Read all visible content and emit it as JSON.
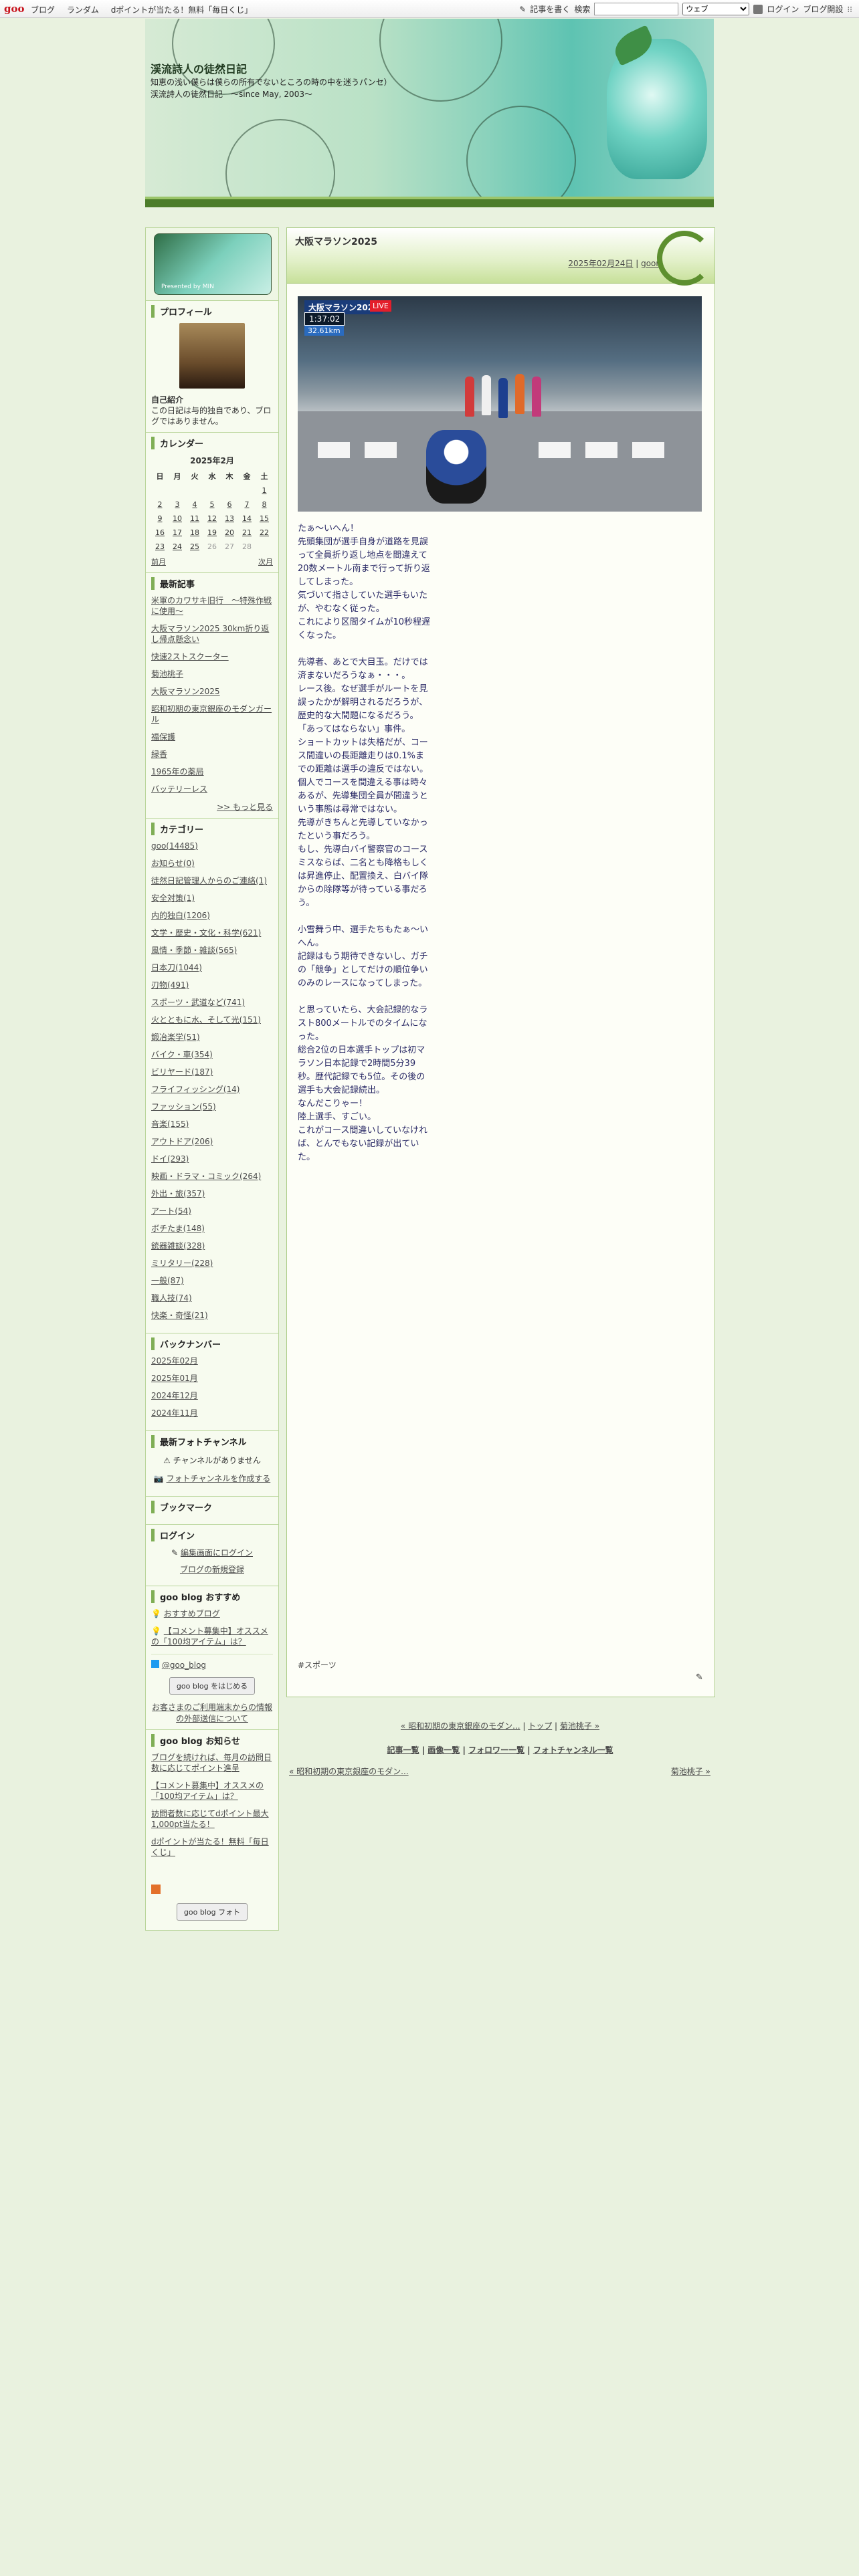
{
  "topbar": {
    "logo": "goo",
    "links": [
      "ブログ",
      "ランダム",
      "dポイントが当たる！無料「毎日くじ」"
    ],
    "write": "記事を書く",
    "search_label": "検索",
    "search_placeholder": "",
    "search_scope": "ウェブ",
    "login": "ログイン",
    "open_blog": "ブログ開設"
  },
  "header": {
    "title": "渓流詩人の徒然日記",
    "description": "知恵の浅い僕らは僕らの所有でないところの時の中を迷うパンセ）渓流詩人の徒然日記　〜since May, 2003〜"
  },
  "sidebar": {
    "badge_text": "Presented by MIN",
    "profile": {
      "heading": "プロフィール",
      "intro_label": "自己紹介",
      "intro_text": "この日記は与的独自であり、ブログではありません。"
    },
    "calendar": {
      "heading": "カレンダー",
      "month": "2025年2月",
      "weekdays": [
        "日",
        "月",
        "火",
        "水",
        "木",
        "金",
        "土"
      ],
      "weeks": [
        [
          "",
          "",
          "",
          "",
          "",
          "",
          "1"
        ],
        [
          "2",
          "3",
          "4",
          "5",
          "6",
          "7",
          "8"
        ],
        [
          "9",
          "10",
          "11",
          "12",
          "13",
          "14",
          "15"
        ],
        [
          "16",
          "17",
          "18",
          "19",
          "20",
          "21",
          "22"
        ],
        [
          "23",
          "24",
          "25",
          "26",
          "27",
          "28",
          ""
        ]
      ],
      "prev": "前月",
      "next": "次月"
    },
    "recent": {
      "heading": "最新記事",
      "items": [
        "米軍のカワサキ旧行　〜特殊作戦に使用〜",
        "大阪マラソン2025 30km折り返し帰点懸念い",
        "快速2ストスクーター",
        "菊池桃子",
        "大阪マラソン2025",
        "昭和初期の東京銀座のモダンガール",
        "福保護",
        "緑香",
        "1965年の薬局",
        "バッテリーレス"
      ],
      "more": ">> もっと見る"
    },
    "categories": {
      "heading": "カテゴリー",
      "items": [
        "goo(14485)",
        "お知らせ(0)",
        "徒然日記管理人からのご連絡(1)",
        "安全対策(1)",
        "内的独白(1206)",
        "文学・歴史・文化・科学(621)",
        "風情・季節・雑談(565)",
        "日本刀(1044)",
        "刃物(491)",
        "スポーツ・武道など(741)",
        "火とともに水、そして光(151)",
        "鍛冶楽学(51)",
        "バイク・車(354)",
        "ビリヤード(187)",
        "フライフィッシング(14)",
        "ファッション(55)",
        "音楽(155)",
        "アウトドア(206)",
        "ドイ(293)",
        "映画・ドラマ・コミック(264)",
        "外出・旅(357)",
        "アート(54)",
        "ボチたま(148)",
        "銃器雑談(328)",
        "ミリタリー(228)",
        "一般(87)",
        "職人技(74)",
        "快楽・奇怪(21)"
      ]
    },
    "backnumber": {
      "heading": "バックナンバー",
      "items": [
        "2025年02月",
        "2025年01月",
        "2024年12月",
        "2024年11月"
      ]
    },
    "photochannel": {
      "heading": "最新フォトチャンネル",
      "none": "チャンネルがありません",
      "create": "フォトチャンネルを作成する"
    },
    "bookmark": {
      "heading": "ブックマーク"
    },
    "login": {
      "heading": "ログイン",
      "edit": "編集画面にログイン",
      "register": "ブログの新規登録"
    },
    "recommend": {
      "heading": "goo blog おすすめ",
      "items": [
        "おすすめブログ",
        "【コメント募集中】オススメの「100均アイテム」は？"
      ],
      "twitter": "@goo_blog",
      "start": "goo blog をはじめる",
      "note": "お客さまのご利用端末からの情報の外部送信について"
    },
    "notice": {
      "heading": "goo blog お知らせ",
      "items": [
        "ブログを続ければ、毎月の訪問日数に応じてポイント進呈",
        "【コメント募集中】オススメの「100均アイテム」は？",
        "訪問者数に応じてdポイント最大1,000pt当たる！",
        "dポイントが当たる！無料「毎日くじ」"
      ],
      "footer_logo": "goo blog フォト"
    }
  },
  "article": {
    "title": "大阪マラソン2025",
    "date": "2025年02月24日",
    "author": "goon",
    "photo": {
      "tag": "大阪マラソン2025",
      "live": "LIVE",
      "clock": "1:37:02",
      "distance": "32.61km"
    },
    "paragraphs": [
      "たぁ〜いへん！\n先頭集団が選手自身が道路を見誤って全員折り返し地点を間違えて20数メートル南まで行って折り返してしまった。\n気づいて指さしていた選手もいたが、やむなく従った。\nこれにより区間タイムが10秒程遅くなった。",
      "先導者、あとで大目玉。だけでは済まないだろうなぁ・・・。\nレース後。なぜ選手がルートを見誤ったかが解明されるだろうが、歴史的な大間題になるだろう。\n「あってはならない」事件。\nショートカットは失格だが、コース間違いの長距離走りは0.1%までの距離は選手の違反ではない。\n個人でコースを間違える事は時々あるが、先導集団全員が間違うという事態は尋常ではない。\n先導がきちんと先導していなかったという事だろう。\nもし、先導白バイ警察官のコースミスならば、二名とも降格もしくは昇進停止、配置換え、白バイ隊からの除隊等が待っている事だろう。",
      "小雪舞う中、選手たちもたぁ〜いへん。\n記録はもう期待できないし、ガチの「競争」としてだけの順位争いのみのレースになってしまった。",
      "と思っていたら、大会記録的なラスト800メートルでのタイムになった。\n総合2位の日本選手トップは初マラソン日本記録で2時間5分39秒。歴代記録でも5位。その後の選手も大会記録続出。\nなんだこりゃー！\n陸上選手、すごい。\nこれがコース間違いしていなければ、とんでもない記録が出ていた。"
    ],
    "tag": "#スポーツ"
  },
  "navigation": {
    "prev_title": "« 昭和初期の東京銀座のモダン...",
    "top": "トップ",
    "next_title": "菊池桃子 »",
    "lists": [
      "記事一覧",
      "画像一覧",
      "フォロワー一覧",
      "フォトチャンネル一覧"
    ],
    "bottom_prev": "« 昭和初期の東京銀座のモダン...",
    "bottom_next": "菊池桃子 »"
  }
}
